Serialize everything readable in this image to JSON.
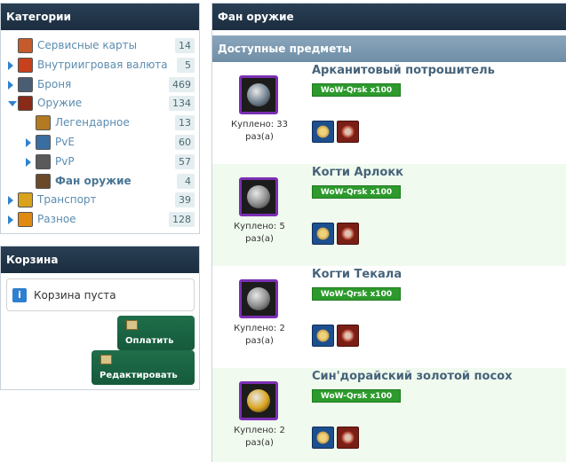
{
  "categories": {
    "title": "Категории",
    "items": [
      {
        "label": "Сервисные карты",
        "count": "14",
        "arrow": "none",
        "indent": 0,
        "active": false,
        "color": "#c55a2a"
      },
      {
        "label": "Внутриигровая валюта",
        "count": "5",
        "arrow": "right",
        "indent": 0,
        "active": false,
        "color": "#c8401c"
      },
      {
        "label": "Броня",
        "count": "469",
        "arrow": "right",
        "indent": 0,
        "active": false,
        "color": "#4b5d72"
      },
      {
        "label": "Оружие",
        "count": "134",
        "arrow": "down",
        "indent": 0,
        "active": false,
        "color": "#8a2b1a"
      },
      {
        "label": "Легендарное",
        "count": "13",
        "arrow": "none",
        "indent": 1,
        "active": false,
        "color": "#b47a22"
      },
      {
        "label": "PvE",
        "count": "60",
        "arrow": "right",
        "indent": 1,
        "active": false,
        "color": "#3a6ea0"
      },
      {
        "label": "PvP",
        "count": "57",
        "arrow": "right",
        "indent": 1,
        "active": false,
        "color": "#5a5a5a"
      },
      {
        "label": "Фан оружие",
        "count": "4",
        "arrow": "none",
        "indent": 1,
        "active": true,
        "color": "#6a4a2a"
      },
      {
        "label": "Транспорт",
        "count": "39",
        "arrow": "right",
        "indent": 0,
        "active": false,
        "color": "#d9a21c"
      },
      {
        "label": "Разное",
        "count": "128",
        "arrow": "right",
        "indent": 0,
        "active": false,
        "color": "#e08a12"
      }
    ]
  },
  "cart": {
    "title": "Корзина",
    "empty_text": "Корзина пуста",
    "info_glyph": "i",
    "pay_label": "Оплатить",
    "edit_label": "Редактировать"
  },
  "main": {
    "title": "Фан оружие",
    "section_title": "Доступные предметы",
    "items": [
      {
        "name": "Арканитовый потрошитель",
        "realm": "WoW-Qrsk x100",
        "bought_line1": "Куплено: 33",
        "bought_line2": "раз(а)",
        "icon_color": "#6f7f8f",
        "alt": false
      },
      {
        "name": "Когти Арлокк",
        "realm": "WoW-Qrsk x100",
        "bought_line1": "Куплено: 5",
        "bought_line2": "раз(а)",
        "icon_color": "#8a8a8a",
        "alt": true
      },
      {
        "name": "Когти Текала",
        "realm": "WoW-Qrsk x100",
        "bought_line1": "Куплено: 2",
        "bought_line2": "раз(а)",
        "icon_color": "#8a8a8a",
        "alt": false
      },
      {
        "name": "Син'дорайский золотой посох",
        "realm": "WoW-Qrsk x100",
        "bought_line1": "Куплено: 2",
        "bought_line2": "раз(а)",
        "icon_color": "#d9a21c",
        "alt": true
      }
    ]
  }
}
